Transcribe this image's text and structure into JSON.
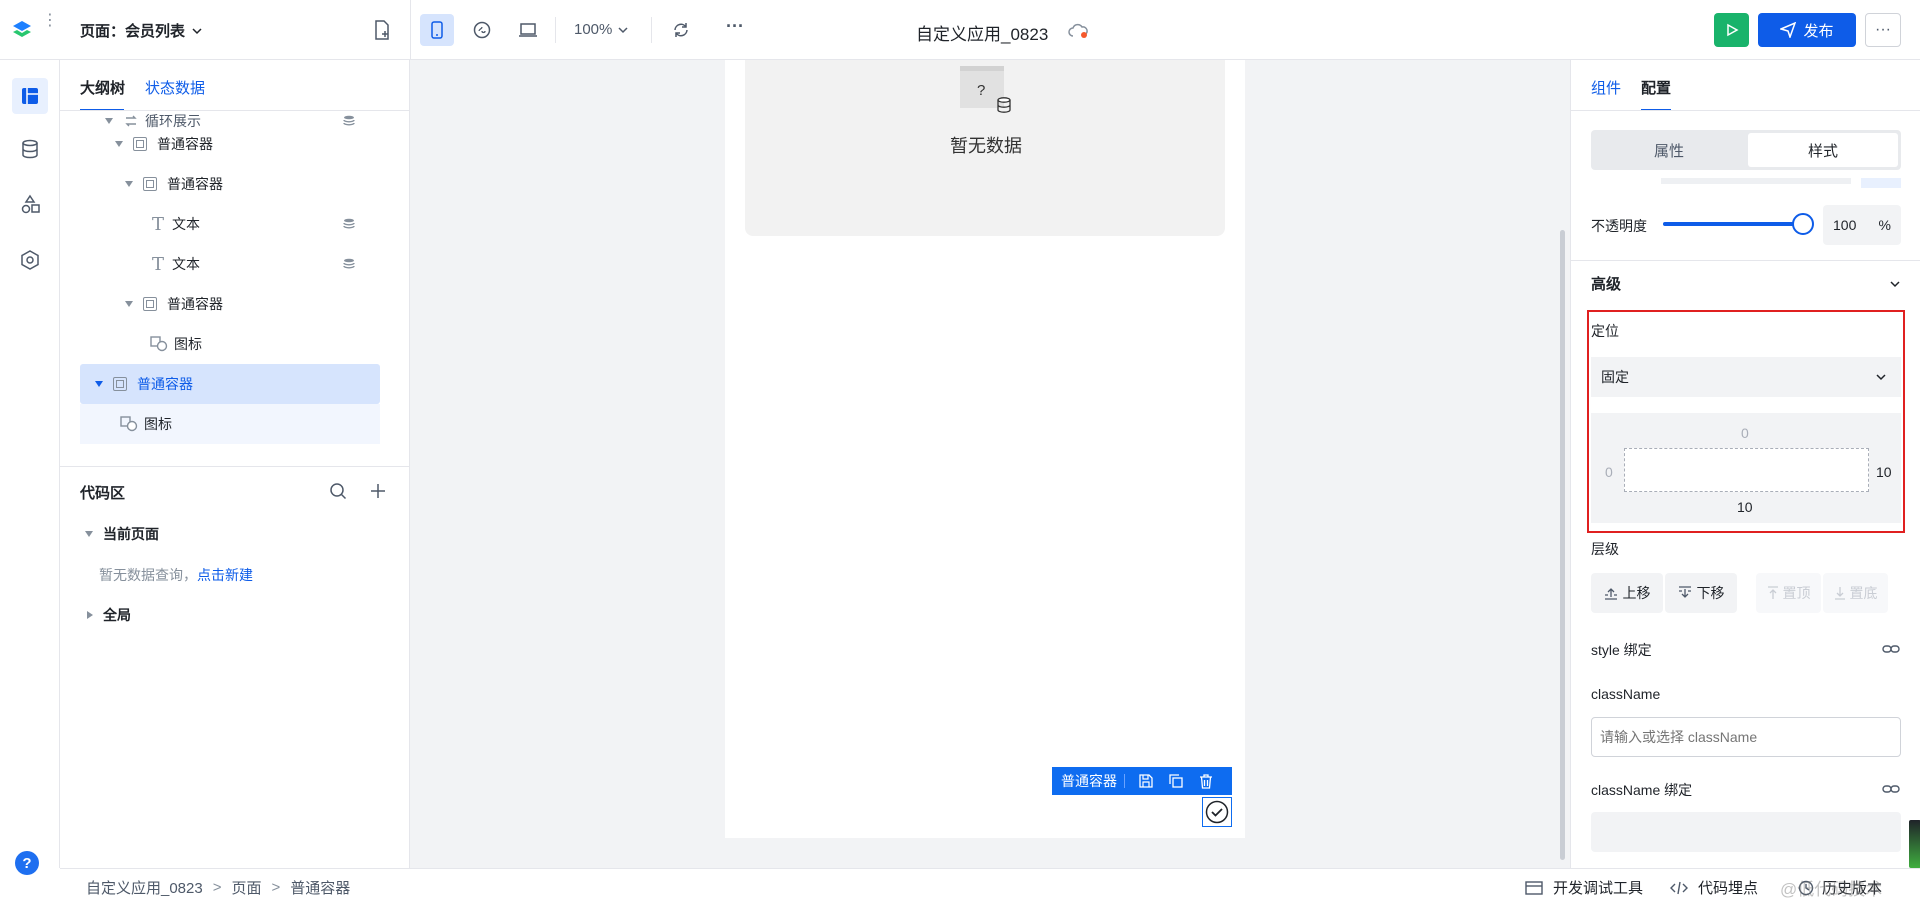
{
  "topbar": {
    "page_selector": "页面：会员列表",
    "zoom": "100%",
    "app_title": "自定义应用_0823",
    "publish_label": "发布",
    "more": "···"
  },
  "left_panel": {
    "tabs": [
      "大纲树",
      "状态数据"
    ],
    "tree": [
      {
        "label": "循环展示",
        "level": 1
      },
      {
        "label": "普通容器",
        "level": 2
      },
      {
        "label": "普通容器",
        "level": 3
      },
      {
        "label": "文本",
        "level": 4
      },
      {
        "label": "文本",
        "level": 4
      },
      {
        "label": "普通容器",
        "level": 3
      },
      {
        "label": "图标",
        "level": 4
      },
      {
        "label": "普通容器",
        "level": 1
      },
      {
        "label": "图标",
        "level": 2
      }
    ],
    "code_area": {
      "title": "代码区",
      "current_page": "当前页面",
      "empty_text": "暂无数据查询，",
      "create_link": "点击新建",
      "global": "全局"
    }
  },
  "canvas": {
    "empty_text": "暂无数据",
    "question_mark": "?",
    "selection_label": "普通容器"
  },
  "right_panel": {
    "tabs": [
      "组件",
      "配置"
    ],
    "segment": [
      "属性",
      "样式"
    ],
    "opacity_label": "不透明度",
    "opacity_value": "100",
    "opacity_unit": "%",
    "opacity_level": 1.0,
    "advanced_label": "高级",
    "position_label": "定位",
    "position_value": "固定",
    "position_box": {
      "top": "0",
      "left": "0",
      "right": "10",
      "bottom": "10"
    },
    "layer_label": "层级",
    "layer_buttons": [
      "上移",
      "下移",
      "置顶",
      "置底"
    ],
    "style_bind_label": "style 绑定",
    "classname_label": "className",
    "classname_placeholder": "请输入或选择 className",
    "classname_bind_label": "className 绑定"
  },
  "statusbar": {
    "breadcrumb": [
      "自定义应用_0823",
      "页面",
      "普通容器"
    ],
    "sep": ">",
    "dev_tools": "开发调试工具",
    "code_tracking": "代码埋点",
    "history": "历史版本",
    "watermark": "@低代码技术"
  },
  "colors": {
    "primary": "#0e5ce8",
    "run_green": "#19b36b",
    "highlight_red": "#e02020",
    "selected_bg": "#d6e4fd"
  }
}
